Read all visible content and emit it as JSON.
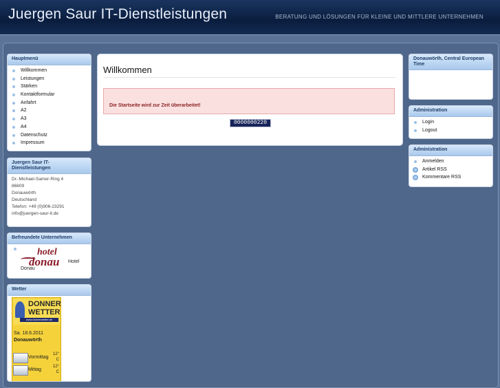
{
  "header": {
    "title": "Juergen Saur IT-Dienstleistungen",
    "slogan": "BERATUNG UND LÖSUNGEN FÜR KLEINE UND MITTLERE UNTERNEHMEN"
  },
  "main_menu": {
    "title": "Hauptmenü",
    "items": [
      "Willkommen",
      "Leistungen",
      "Stärken",
      "Kontaktformular",
      "Anfahrt",
      "A2",
      "A3",
      "A4",
      "Datenschutz",
      "Impressum"
    ]
  },
  "company": {
    "title": "Juergen Saur IT-Dienstleistungen",
    "lines": [
      "Dr.-Michael-Samer-Ring 4",
      "86609",
      "Donauwörth",
      "Deutschland",
      "Telefon: +49 (0)906-23291",
      "info@juergen-saur-it.de"
    ]
  },
  "friends": {
    "title": "Befreundete Unternehmen",
    "logo_line1": "hotel",
    "logo_line2": "donau",
    "name_part1": "Hotel",
    "name_part2": "Donau"
  },
  "weather": {
    "title": "Wetter",
    "logo_line1": "DONNER",
    "logo_line2": "WETTER",
    "logo_url": "www.donnerwetter.de",
    "date": "Sa. 18.6.2011",
    "place": "Donauwörth",
    "rows": [
      {
        "label": "Vormittag",
        "temp": "12°",
        "unit": "C"
      },
      {
        "label": "Mittag",
        "temp": "12°",
        "unit": "C"
      }
    ]
  },
  "main": {
    "title": "Willkommen",
    "notice": "Die Startseite wird zur Zeit überarbeitet!",
    "counter": "0000000220"
  },
  "timezone": {
    "title": "Donauwörth, Central European Time"
  },
  "admin1": {
    "title": "Administration",
    "items": [
      "Login",
      "Logout"
    ]
  },
  "admin2": {
    "title": "Administration",
    "items": [
      "Anmelden",
      "Artikel RSS",
      "Kommentare RSS"
    ]
  },
  "colors": {
    "background": "#5a7396",
    "header": "#0a1d3e",
    "box_head": "#a9c9ec",
    "notice_bg": "#fbe0e0",
    "notice_text": "#8a2323"
  }
}
